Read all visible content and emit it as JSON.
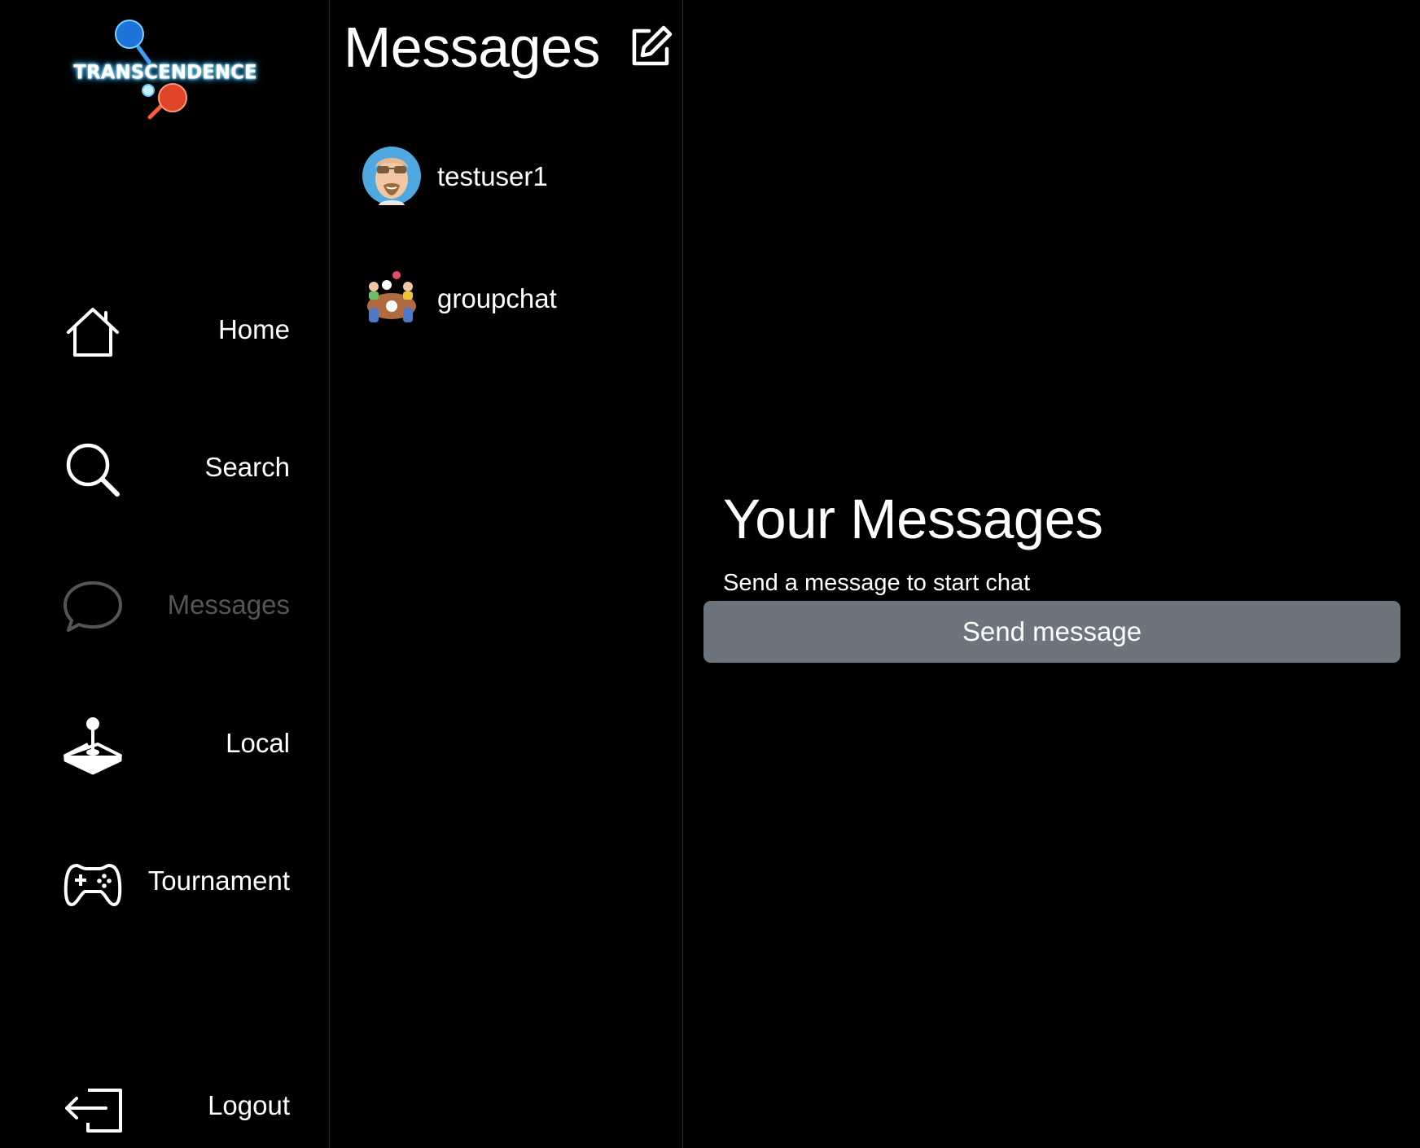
{
  "logo": {
    "text": "TRANSCENDENCE"
  },
  "sidebar": {
    "items": [
      {
        "label": "Home",
        "icon": "home-icon"
      },
      {
        "label": "Search",
        "icon": "search-icon"
      },
      {
        "label": "Messages",
        "icon": "chat-bubble-icon",
        "active": true
      },
      {
        "label": "Local",
        "icon": "joystick-icon"
      },
      {
        "label": "Tournament",
        "icon": "gamepad-icon"
      },
      {
        "label": "Logout",
        "icon": "logout-icon"
      }
    ]
  },
  "conversations": {
    "title": "Messages",
    "compose_icon": "compose-icon",
    "items": [
      {
        "name": "testuser1",
        "avatar": "user-avatar"
      },
      {
        "name": "groupchat",
        "avatar": "group-avatar"
      }
    ]
  },
  "main": {
    "title": "Your Messages",
    "subtitle": "Send a message to start chat",
    "button_label": "Send message"
  },
  "colors": {
    "background": "#000000",
    "button": "#6c757d",
    "inactive_text": "#555555",
    "divider": "#2a2a2a"
  }
}
